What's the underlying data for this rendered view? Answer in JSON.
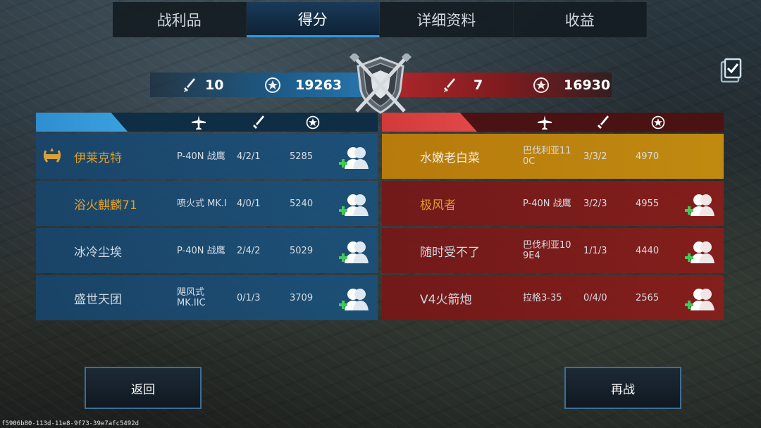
{
  "tabs": [
    {
      "label": "战利品"
    },
    {
      "label": "得分",
      "active": true
    },
    {
      "label": "详细资料"
    },
    {
      "label": "收益"
    }
  ],
  "score": {
    "blue": {
      "kills": "10",
      "points": "19263"
    },
    "red": {
      "kills": "7",
      "points": "16930"
    }
  },
  "colors": {
    "blue_team": "#1d5a86",
    "red_team": "#a8262a",
    "highlight": "#c08a10",
    "gold_name": "#e0a02a"
  },
  "icons": {
    "header": [
      "plane-icon",
      "sword-icon",
      "star-laurel-icon"
    ],
    "friend": "add-friend-icon",
    "clipboard": "clipboard-check-icon",
    "badge": "laurel-badge-icon"
  },
  "blue_team": [
    {
      "name": "伊莱克特",
      "plane": "P-40N 战鹰",
      "kda": "4/2/1",
      "points": "5285",
      "badge": true,
      "gold": true
    },
    {
      "name": "浴火麒麟71",
      "plane": "喷火式 MK.I",
      "kda": "4/0/1",
      "points": "5240",
      "gold": true
    },
    {
      "name": "冰冷尘埃",
      "plane": "P-40N 战鹰",
      "kda": "2/4/2",
      "points": "5029"
    },
    {
      "name": "盛世天团",
      "plane": "飓风式 MK.IIC",
      "kda": "0/1/3",
      "points": "3709"
    }
  ],
  "red_team": [
    {
      "name": "水嫩老白菜",
      "plane": "巴伐利亚11 0C",
      "kda": "3/3/2",
      "points": "4970",
      "highlight": true
    },
    {
      "name": "极风者",
      "plane": "P-40N 战鹰",
      "kda": "3/2/3",
      "points": "4955",
      "gold": true
    },
    {
      "name": "随时受不了",
      "plane": "巴伐利亚10 9E4",
      "kda": "1/1/3",
      "points": "4440"
    },
    {
      "name": "V4火箭炮",
      "plane": "拉格3-35",
      "kda": "0/4/0",
      "points": "2565"
    }
  ],
  "buttons": {
    "back": "返回",
    "rematch": "再战"
  },
  "footer_id": "f5906b80-113d-11e8-9f73-39e7afc5492d"
}
